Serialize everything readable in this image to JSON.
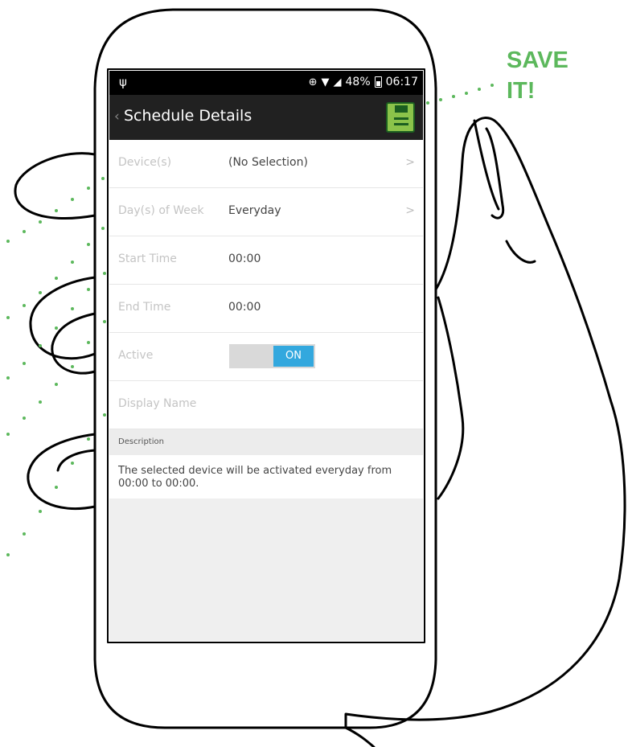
{
  "callout": {
    "text": "SAVE IT!"
  },
  "status_bar": {
    "battery": "48%",
    "time": "06:17"
  },
  "action_bar": {
    "back_icon": "‹",
    "title": "Schedule Details",
    "save_icon": "floppy-disk-icon"
  },
  "rows": [
    {
      "label": "Device(s)",
      "value": "(No Selection)",
      "chevron": ">"
    },
    {
      "label": "Day(s) of Week",
      "value": "Everyday",
      "chevron": ">"
    },
    {
      "label": "Start Time",
      "value": "00:00"
    },
    {
      "label": "End Time",
      "value": "00:00"
    },
    {
      "label": "Active",
      "toggle": "ON"
    },
    {
      "label": "Display Name",
      "value": ""
    }
  ],
  "description": {
    "header": "Description",
    "text": "The selected device will be activated everyday from 00:00 to 00:00."
  },
  "colors": {
    "accent": "#33a8de",
    "save_green": "#8bc34a",
    "callout_green": "#5cb85c",
    "action_bar": "#212121"
  }
}
